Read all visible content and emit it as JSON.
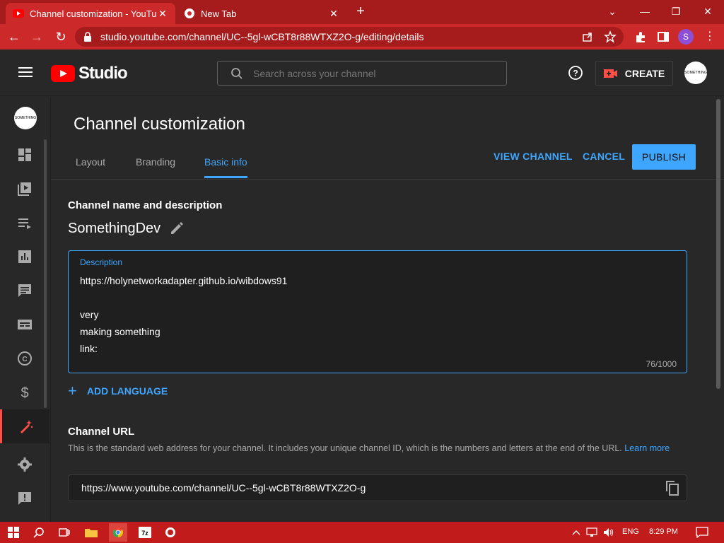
{
  "browser": {
    "tabs": [
      {
        "title": "Channel customization - YouTube Studio",
        "active": true
      },
      {
        "title": "New Tab",
        "active": false
      }
    ],
    "url": "studio.youtube.com/channel/UC--5gl-wCBT8r88WTXZ2O-g/editing/details",
    "profile_initial": "S"
  },
  "header": {
    "logo_text": "Studio",
    "search_placeholder": "Search across your channel",
    "create_label": "CREATE",
    "avatar_text": "SOMETHING"
  },
  "rail": {
    "avatar_text": "SOMETHING",
    "items": [
      {
        "name": "dashboard-icon"
      },
      {
        "name": "content-icon"
      },
      {
        "name": "playlists-icon"
      },
      {
        "name": "analytics-icon"
      },
      {
        "name": "comments-icon"
      },
      {
        "name": "subtitles-icon"
      },
      {
        "name": "copyright-icon"
      },
      {
        "name": "earn-icon"
      },
      {
        "name": "customization-icon",
        "active": true
      },
      {
        "name": "settings-icon"
      },
      {
        "name": "feedback-icon"
      }
    ]
  },
  "page": {
    "title": "Channel customization",
    "tabs": [
      "Layout",
      "Branding",
      "Basic info"
    ],
    "active_tab": "Basic info",
    "view_channel": "VIEW CHANNEL",
    "cancel": "CANCEL",
    "publish": "PUBLISH"
  },
  "basic_info": {
    "section_heading": "Channel name and description",
    "channel_name": "SomethingDev",
    "description_label": "Description",
    "description": "https://holynetworkadapter.github.io/wibdows91\n\nvery\nmaking something\nlink:",
    "char_count": "76/1000",
    "add_language": "ADD LANGUAGE",
    "url_heading": "Channel URL",
    "url_help": "This is the standard web address for your channel. It includes your unique channel ID, which is the numbers and letters at the end of the URL.",
    "learn_more": "Learn more",
    "channel_url": "https://www.youtube.com/channel/UC--5gl-wCBT8r88WTXZ2O-g"
  },
  "taskbar": {
    "language": "ENG",
    "time": "8:29 PM"
  },
  "colors": {
    "accent_blue": "#3ea6ff",
    "browser_red": "#cc2a2a",
    "yt_red": "#ff0000",
    "bg": "#282828"
  }
}
